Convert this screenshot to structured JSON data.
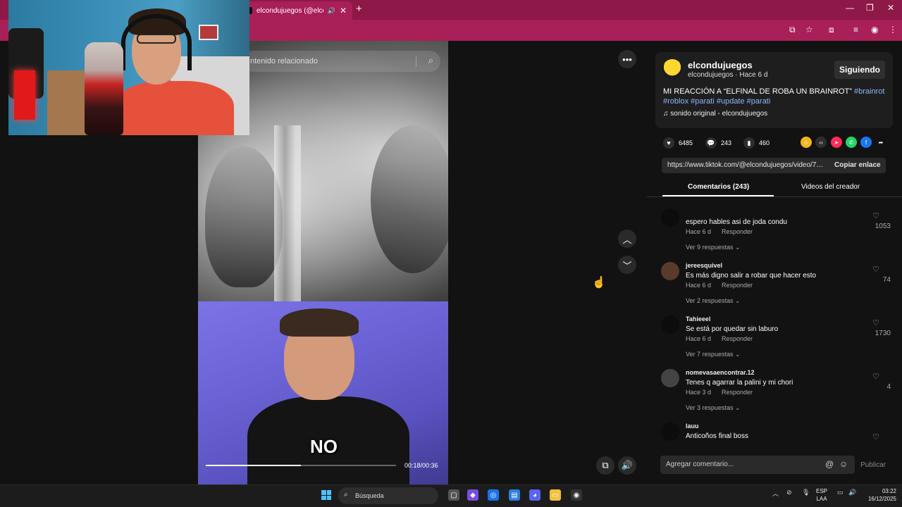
{
  "browser": {
    "tab_title": "elcondujuegos (@elcondujue",
    "new_tab": "+"
  },
  "search": {
    "placeholder": "ntenido relacionado"
  },
  "video": {
    "caption": "NO",
    "time_label": "00:18/00:36",
    "progress": 0.5
  },
  "author": {
    "name": "elcondujuegos",
    "subtitle": "elcondujuegos · Hace 6 d",
    "follow_label": "Siguiendo"
  },
  "post": {
    "description_text": "MI REACCIÓN A “ELFINAL DE ROBA UN BRAINROT” ",
    "tags": [
      "#brainrot",
      "#roblox",
      "#parati",
      "#update",
      "#parati"
    ],
    "music": "sonido original - elcondujuegos"
  },
  "stats": {
    "likes": "6485",
    "comments": "243",
    "saves": "460"
  },
  "share": {
    "url": "https://www.tiktok.com/@elcondujuegos/video/75...",
    "copy_label": "Copiar enlace"
  },
  "tabs": {
    "comments": "Comentarios (243)",
    "creator_videos": "Videos del creador"
  },
  "comments": [
    {
      "user": "",
      "text": "espero hables asi de joda condu",
      "time": "Hace 6 d",
      "reply": "Responder",
      "more": "Ver 9 respuestas ⌄",
      "likes": "1053"
    },
    {
      "user": "jereesquivel",
      "text": "Es más digno salir a robar que hacer esto",
      "time": "Hace 6 d",
      "reply": "Responder",
      "more": "Ver 2 respuestas ⌄",
      "likes": "74"
    },
    {
      "user": "Tahieeel",
      "text": "Se está por quedar sin laburo",
      "time": "Hace 6 d",
      "reply": "Responder",
      "more": "Ver 7 respuestas ⌄",
      "likes": "1730"
    },
    {
      "user": "nomevasaencontrar.12",
      "text": "Tenes q agarrar la palini y mi chori",
      "time": "Hace 3 d",
      "reply": "Responder",
      "more": "Ver 3 respuestas ⌄",
      "likes": "4"
    },
    {
      "user": "lauu",
      "text": "Anticoños final boss",
      "time": "",
      "reply": "",
      "more": "",
      "likes": ""
    }
  ],
  "comment_box": {
    "placeholder": "Agregar comentario...",
    "publish": "Publicar"
  },
  "taskbar": {
    "search": "Búsqueda",
    "lang_top": "ESP",
    "lang_bottom": "LAA",
    "time": "03:22",
    "date": "16/12/2025"
  },
  "colors": {
    "browser_frame": "#8e1848",
    "tag_link": "#8fb6ff",
    "panel_bg": "#121212"
  }
}
